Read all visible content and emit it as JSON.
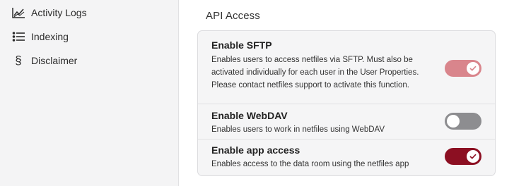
{
  "sidebar": {
    "items": [
      {
        "label": "Activity Logs",
        "icon": "activity-chart-icon"
      },
      {
        "label": "Indexing",
        "icon": "list-icon"
      },
      {
        "label": "Disclaimer",
        "icon": "section-sign-icon"
      }
    ]
  },
  "main": {
    "section_title": "API Access",
    "settings": [
      {
        "title": "Enable SFTP",
        "description": "Enables users to access netfiles via SFTP. Must also be activated individually for each user in the User Properties. Please contact netfiles support to activate this function.",
        "enabled": true,
        "disabled": true
      },
      {
        "title": "Enable WebDAV",
        "description": "Enables users to work in netfiles using WebDAV",
        "enabled": false,
        "disabled": false
      },
      {
        "title": "Enable app access",
        "description": "Enables access to the data room using the netfiles app",
        "enabled": true,
        "disabled": false
      }
    ]
  },
  "colors": {
    "accent": "#8c0f22",
    "accent_disabled": "#d9858c",
    "toggle_off": "#8d8d90"
  }
}
